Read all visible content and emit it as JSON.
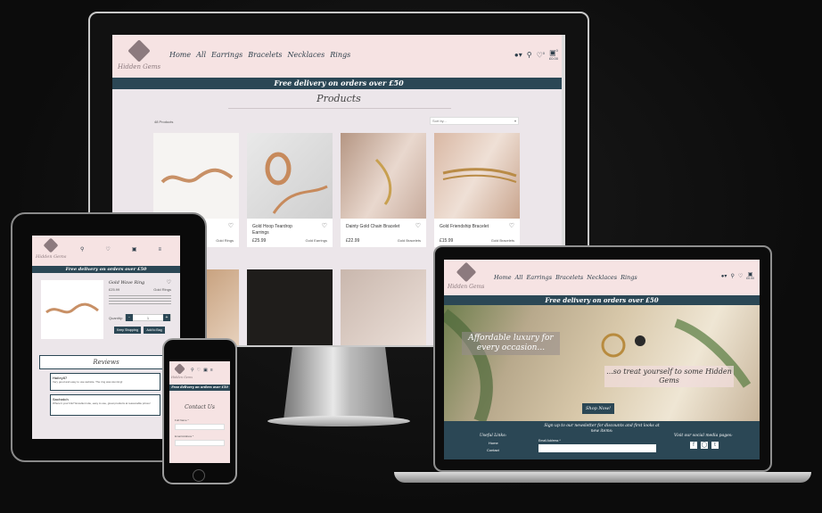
{
  "site": {
    "logo_text": "Hidden Gems",
    "nav": [
      "Home",
      "All",
      "Earrings",
      "Bracelets",
      "Necklaces",
      "Rings"
    ],
    "cart_total": "£0.00",
    "cart_count": "0",
    "wishlist_count": "0",
    "banner": "Free delivery on orders over £50"
  },
  "desktop": {
    "heading": "Products",
    "count": "48 Products",
    "sort_placeholder": "Sort by...",
    "products": [
      {
        "name": "",
        "price": "",
        "category": "Gold Rings"
      },
      {
        "name": "Gold Hoop Teardrop Earrings",
        "price": "£25.99",
        "category": "Gold Earrings"
      },
      {
        "name": "Dainty Gold Chain Bracelet",
        "price": "£22.99",
        "category": "Gold Bracelets"
      },
      {
        "name": "Gold Friendship Bracelet",
        "price": "£15.99",
        "category": "Gold Bracelets"
      }
    ]
  },
  "tablet": {
    "product_name": "Gold Wave Ring",
    "price": "£25.99",
    "category": "Gold Rings",
    "quantity_label": "Quantity:",
    "quantity_value": "1",
    "keep_shopping": "Keep Shopping",
    "add_to_bag": "Add to Bag",
    "reviews_title": "Reviews",
    "review1_user": "Hailey87",
    "review1_text": "Very good and easy to use website. The ring was stunning!",
    "review2_user": "Sachatch",
    "review2_text": "Where's your link? Excellent site, easy to use, great products at reasonable prices!"
  },
  "phone": {
    "heading": "Contact Us",
    "full_name_label": "Full Name *",
    "email_label": "Email Address *"
  },
  "laptop": {
    "hero_line1": "Affordable luxury for every occasion...",
    "hero_line2": "...so treat yourself to some Hidden Gems",
    "shop_now": "Shop Now!",
    "newsletter": "Sign up to our newsletter for discounts and first looks at new items:",
    "email_label": "Email Address *",
    "useful_links": "Useful Links:",
    "link_home": "Home",
    "link_contact": "Contact",
    "social": "Visit our social media pages:"
  },
  "colors": {
    "banner": "#2b4755",
    "header": "#f6e3e3",
    "accent": "#8c7a7e"
  }
}
